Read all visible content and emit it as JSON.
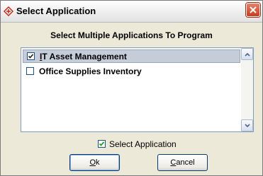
{
  "window": {
    "title": "Select Application"
  },
  "heading": "Select Multiple Applications To Program",
  "applications": [
    {
      "mnemonic": "I",
      "rest": "T Asset Management",
      "checked": true,
      "selected": true
    },
    {
      "mnemonic": "",
      "rest": "Office Supplies Inventory",
      "checked": false,
      "selected": false
    }
  ],
  "select_all": {
    "label": "Select Application",
    "checked": true
  },
  "buttons": {
    "ok": {
      "mnemonic": "O",
      "rest": "k"
    },
    "cancel": {
      "mnemonic": "C",
      "rest": "ancel"
    }
  },
  "colors": {
    "dialog_bg": "#ece9d8",
    "list_selection": "#c5cdd9",
    "close_red": "#c53d1f",
    "check_green": "#21a121"
  },
  "icons": {
    "title": "app-diamond-icon",
    "close": "close-icon",
    "scroll_up": "chevron-up-icon",
    "scroll_down": "chevron-down-icon"
  }
}
